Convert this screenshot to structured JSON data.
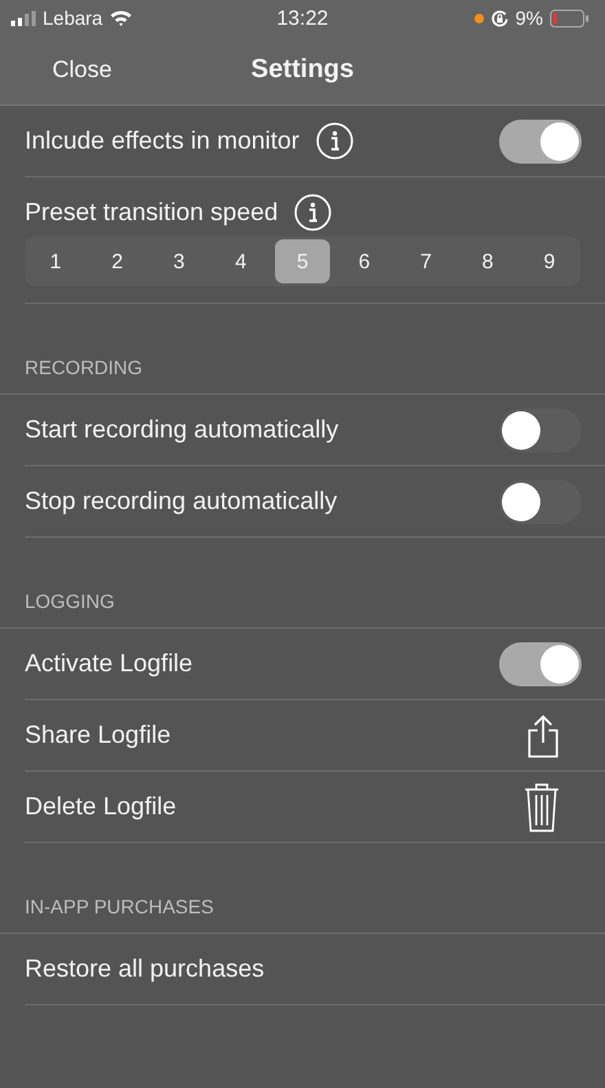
{
  "status_bar": {
    "carrier": "Lebara",
    "time": "13:22",
    "battery": "9%"
  },
  "nav": {
    "left": "Close",
    "title": "Settings"
  },
  "sections": [
    {
      "rows": [
        {
          "kind": "toggle",
          "label": "Inlcude effects in monitor",
          "info": true,
          "on": true
        },
        {
          "kind": "segmented",
          "label": "Preset transition speed",
          "info": true,
          "options": [
            {
              "label": "1",
              "selected": false
            },
            {
              "label": "2",
              "selected": false
            },
            {
              "label": "3",
              "selected": false
            },
            {
              "label": "4",
              "selected": false
            },
            {
              "label": "5",
              "selected": true
            },
            {
              "label": "6",
              "selected": false
            },
            {
              "label": "7",
              "selected": false
            },
            {
              "label": "8",
              "selected": false
            },
            {
              "label": "9",
              "selected": false
            }
          ]
        }
      ]
    },
    {
      "header": "RECORDING",
      "rows": [
        {
          "kind": "toggle",
          "label": "Start recording automatically",
          "on": false
        },
        {
          "kind": "toggle",
          "label": "Stop recording automatically",
          "on": false
        }
      ]
    },
    {
      "header": "LOGGING",
      "rows": [
        {
          "kind": "toggle",
          "label": "Activate Logfile",
          "on": true
        },
        {
          "kind": "share",
          "label": "Share Logfile"
        },
        {
          "kind": "delete",
          "label": "Delete Logfile"
        }
      ]
    },
    {
      "header": "IN-APP PURCHASES",
      "rows": [
        {
          "kind": "plain",
          "label": "Restore all purchases"
        }
      ]
    }
  ]
}
